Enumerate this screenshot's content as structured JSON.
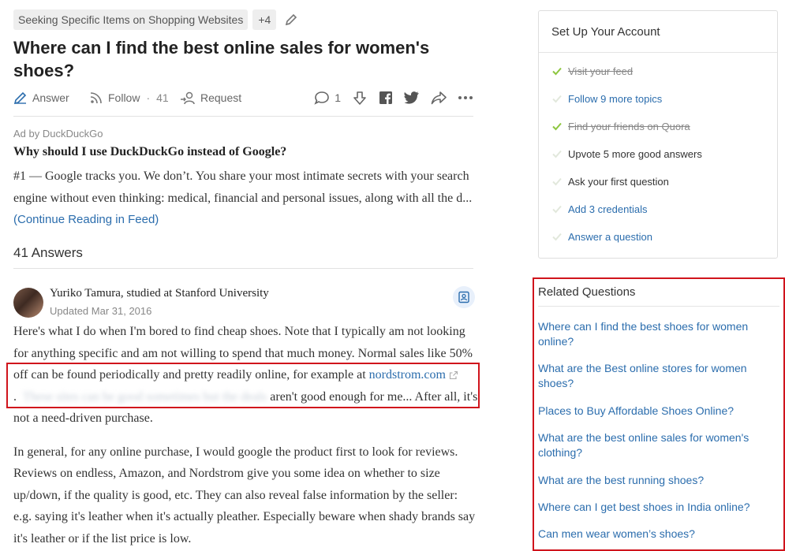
{
  "topics": {
    "chip": "Seeking Specific Items on Shopping Websites",
    "more": "+4"
  },
  "question": {
    "title": "Where can I find the best online sales for women's shoes?"
  },
  "actions": {
    "answer": "Answer",
    "follow": "Follow",
    "follow_separator": "·",
    "follow_count": "41",
    "request": "Request",
    "comments_count": "1"
  },
  "ad": {
    "by": "Ad by DuckDuckGo",
    "title": "Why should I use DuckDuckGo instead of Google?",
    "body": "#1 — Google tracks you. We don’t. You share your most intimate secrets with your search engine without even thinking: medical, financial and personal issues, along with all the d...",
    "link": "(Continue Reading in Feed)"
  },
  "answers_count": "41 Answers",
  "answer": {
    "author": "Yuriko Tamura, studied at Stanford University",
    "updated": "Updated Mar 31, 2016",
    "p1_part1": "Here's what I do when I'm bored to find cheap shoes.  Note that I typically am not looking for anything specific and am not willing to spend that much money.  Normal sales like 50% off can be found periodically and pretty readily online, for example at ",
    "p1_link": "nordstrom.com",
    "p1_blurred": "These sites can be good sometimes but the deals",
    "p1_part2": ".",
    "p1_part3": "aren't good enough for me... After all, it's not a need-driven purchase.",
    "p2": "In general, for any online purchase, I would google the product first to look for reviews.  Reviews on endless, Amazon, and Nordstrom give you some idea on whether to size up/down, if the quality is good, etc.  They can also reveal false information by the seller: e.g. saying it's leather when it's actually pleather. Especially beware when shady brands say it's leather or if the list price is low."
  },
  "setup": {
    "title": "Set Up Your Account",
    "items": [
      {
        "label": "Visit your feed",
        "state": "done"
      },
      {
        "label": "Follow 9 more topics",
        "state": "link"
      },
      {
        "label": "Find your friends on Quora",
        "state": "done"
      },
      {
        "label": "Upvote 5 more good answers",
        "state": "plain"
      },
      {
        "label": "Ask your first question",
        "state": "plain"
      },
      {
        "label": "Add 3 credentials",
        "state": "link"
      },
      {
        "label": "Answer a question",
        "state": "link"
      }
    ]
  },
  "related": {
    "title": "Related Questions",
    "items": [
      "Where can I find the best shoes for women online?",
      "What are the Best online stores for women shoes?",
      "Places to Buy Affordable Shoes Online?",
      "What are the best online sales for women's clothing?",
      "What are the best running shoes?",
      "Where can I get best shoes in India online?",
      "Can men wear women’s shoes?"
    ]
  },
  "colors": {
    "link": "#2b6dad",
    "check_done": "#8dc63f",
    "check_pending": "#cfe3b8",
    "highlight_border": "#d0141c"
  }
}
